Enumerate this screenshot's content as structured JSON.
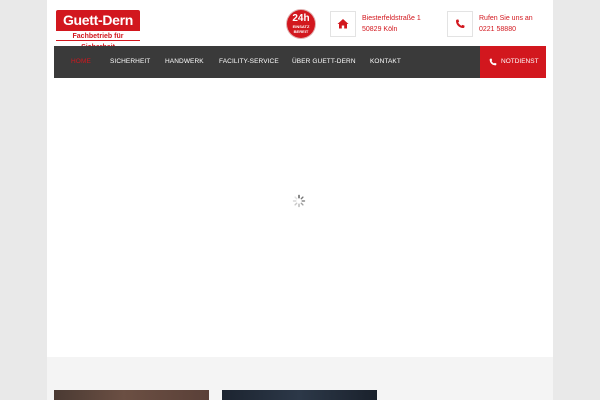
{
  "header": {
    "logo_name": "Guett-Dern",
    "logo_tagline": "Fachbetrieb für Sicherheit",
    "badge_main": "24h",
    "badge_sub_1": "EINSATZ",
    "badge_sub_2": "BEREIT",
    "address_line1": "Biesterfeldstraße 1",
    "address_line2": "50829 Köln",
    "phone_line1": "Rufen Sie uns an",
    "phone_line2": "0221 58880"
  },
  "nav": {
    "items": [
      {
        "label": "HOME",
        "active": true
      },
      {
        "label": "SICHERHEIT",
        "active": false
      },
      {
        "label": "HANDWERK",
        "active": false
      },
      {
        "label": "FACILITY-SERVICE",
        "active": false
      },
      {
        "label": "ÜBER GUETT-DERN",
        "active": false
      },
      {
        "label": "KONTAKT",
        "active": false
      }
    ],
    "notdienst_label": "NOTDIENST"
  },
  "icons": {
    "address": "home-icon",
    "phone": "phone-icon",
    "notdienst": "phone-icon",
    "loading": "loading-spinner-icon"
  },
  "colors": {
    "brand": "#d2171e",
    "nav_bg": "#3a3a3a"
  }
}
